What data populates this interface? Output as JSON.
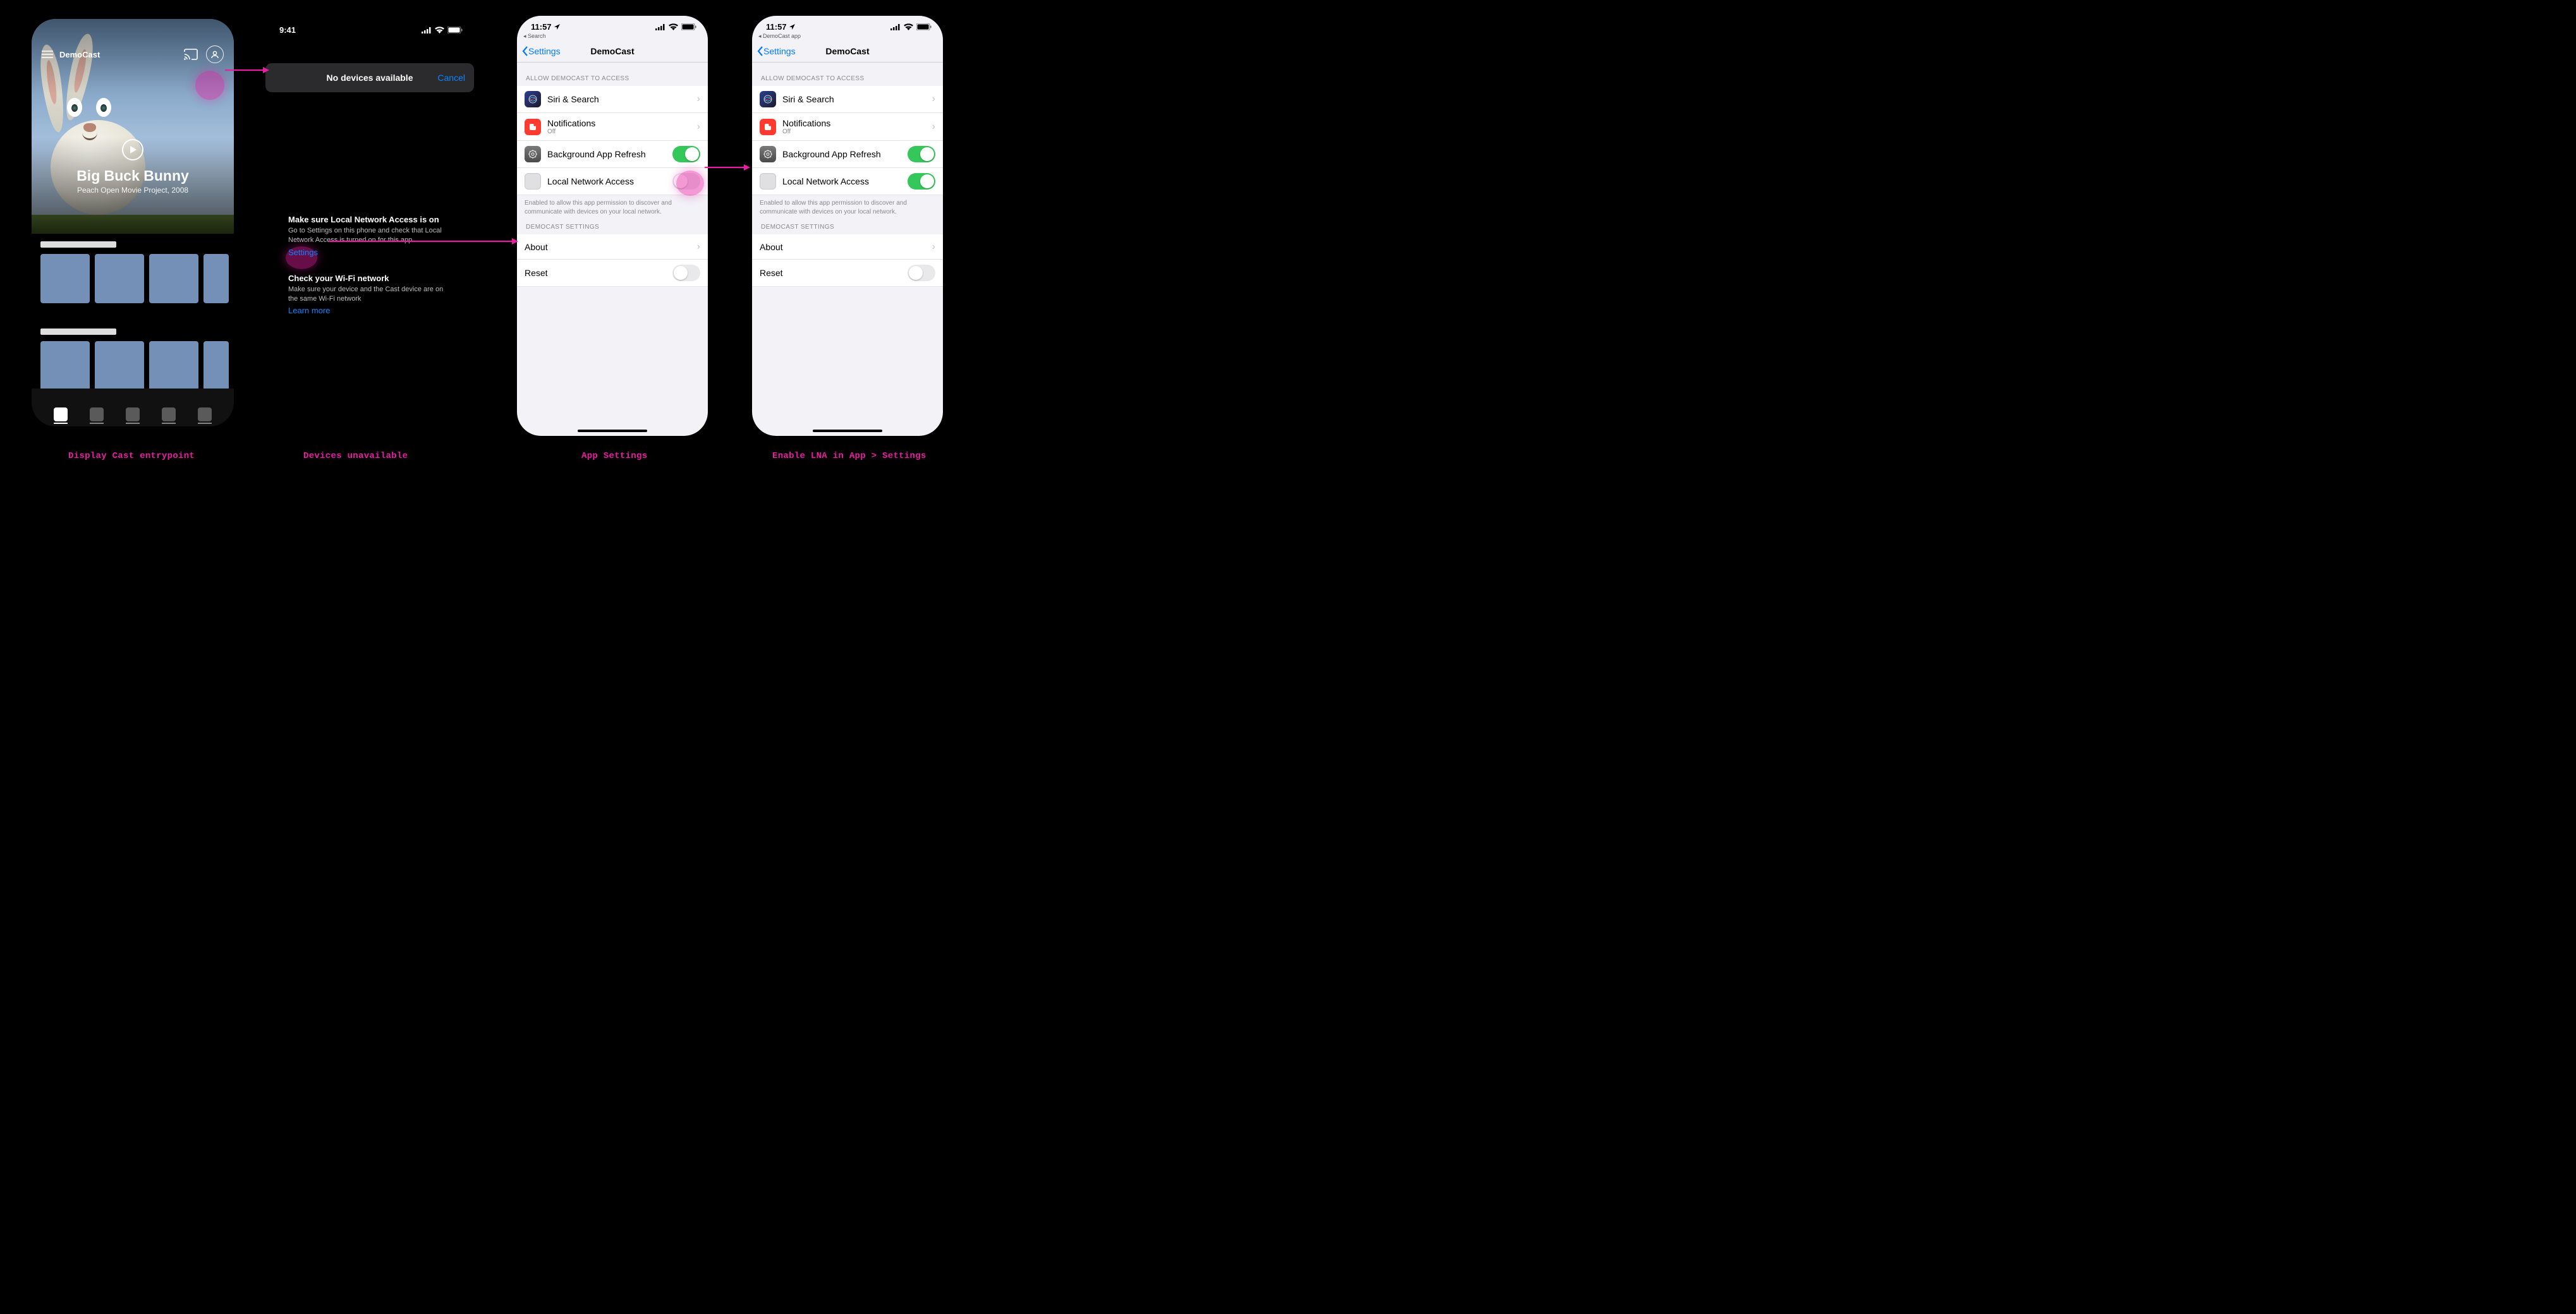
{
  "status_time_941": "9:41",
  "status_time_1157": "11:57",
  "p1": {
    "app_title": "DemoCast",
    "hero_title": "Big Buck Bunny",
    "hero_sub": "Peach Open Movie Project, 2008"
  },
  "p2": {
    "popup_title": "No devices available",
    "popup_cancel": "Cancel",
    "lna_heading": "Make sure Local Network Access is on",
    "lna_body": "Go to Settings on this phone and check that Local Network Access is turned on for this app",
    "lna_link": "Settings",
    "wifi_heading": "Check your Wi-Fi network",
    "wifi_body": "Make sure your device and the Cast device are on the same Wi-Fi network",
    "wifi_link": "Learn more"
  },
  "settings": {
    "crumb_search": "Search",
    "crumb_app": "DemoCast app",
    "back": "Settings",
    "title": "DemoCast",
    "allow_header": "ALLOW DEMOCAST TO ACCESS",
    "siri": "Siri & Search",
    "notif": "Notifications",
    "notif_sub": "Off",
    "bg": "Background App Refresh",
    "lna": "Local Network Access",
    "lna_footer": "Enabled to allow this app permission to discover and communicate with devices on your local network.",
    "app_header": "DEMOCAST SETTINGS",
    "about": "About",
    "reset": "Reset"
  },
  "captions": {
    "c1": "Display Cast entrypoint",
    "c2": "Devices unavailable",
    "c3": "App Settings",
    "c4": "Enable LNA in App > Settings"
  }
}
